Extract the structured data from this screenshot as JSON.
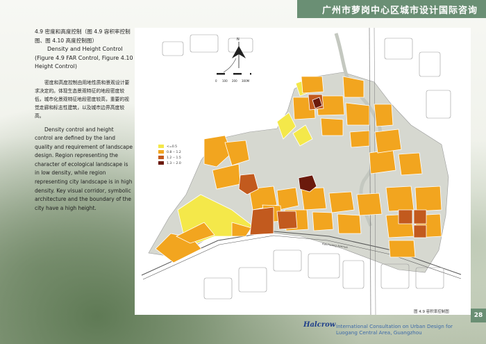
{
  "header": {
    "title": "广州市萝岗中心区城市设计国际咨询"
  },
  "section": {
    "heading_cn": "4.9 密度和高度控制（图 4.9 容积率控制图、图 4.10 高度控制图）",
    "heading_en": "Density and Height Control (Figure 4.9 FAR Control, Figure 4.10 Height Control)",
    "body_cn": "密度和高度控制由用地性质和景观设计要求决定的。体现生态景观特征的地段密度较低，城市化景观特征地段密度较高，重要的视觉走廊和标志性建筑，以及城市边界高度较高。",
    "body_en": "Density control and height control are defined by the land quality and requirement of landscape design. Region representing the character of ecological landscape is in low density, while region representing city landscape is in high density. Key visual corridor, symbolic architecture and the boundary of the city have a high height."
  },
  "map": {
    "north_label": "N",
    "scale_labels": [
      "0",
      "100",
      "200",
      "300M"
    ],
    "legend": [
      {
        "label": "<=0.5",
        "color": "#f4e84a"
      },
      {
        "label": "0.8 -- 1.2",
        "color": "#f2a51f"
      },
      {
        "label": "1.2 -- 1.5",
        "color": "#c25a1e"
      },
      {
        "label": "1.3 -- 2.0",
        "color": "#6b1a0c"
      }
    ],
    "road_label": "Kaichuang Avenue",
    "caption": "图 4.9 容积率控制图"
  },
  "page": {
    "number": "28"
  },
  "footer": {
    "logo": "Halcrow",
    "line1": "International Consultation  on Urban Design for",
    "line2": "Luogang Central Area, Guangzhou"
  },
  "colors": {
    "accent": "#6a8f74",
    "green_space": "#d6d8d0",
    "low": "#f4e84a",
    "mid": "#f2a51f",
    "high": "#c25a1e",
    "top": "#6b1a0c"
  }
}
